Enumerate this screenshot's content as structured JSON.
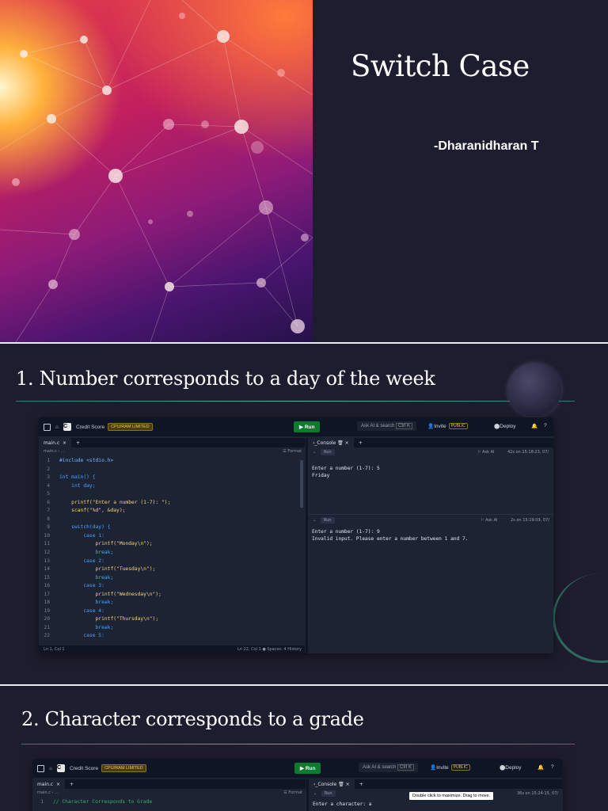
{
  "slide1": {
    "title": "Switch Case",
    "author": "-Dharanidharan T"
  },
  "slide2": {
    "heading": "1. Number corresponds to a day of the week",
    "app": {
      "project_name": "Credit Score",
      "resource_badge": "CPU/RAM LIMITED",
      "run_label": "Run",
      "ask_ai": "Ask AI & search",
      "shortcut": "Ctrl K",
      "invite": "Invite",
      "public_badge": "PUBLIC",
      "deploy": "Deploy",
      "help": "?",
      "file_tab": "main.c",
      "console_tab": "Console",
      "breadcrumb": "main.c › ...",
      "format": "Format",
      "status_left": "Ln 1, Col 1",
      "status_right": "Ln 22, Col 1  ●  Spaces: 4  History",
      "code_lines": [
        {
          "n": "1",
          "t": "#include <stdio.h>"
        },
        {
          "n": "2",
          "t": ""
        },
        {
          "n": "3",
          "t": "int main() {"
        },
        {
          "n": "4",
          "t": "    int day;"
        },
        {
          "n": "5",
          "t": ""
        },
        {
          "n": "6",
          "t": "    printf(\"Enter a number (1-7): \");"
        },
        {
          "n": "7",
          "t": "    scanf(\"%d\", &day);"
        },
        {
          "n": "8",
          "t": ""
        },
        {
          "n": "9",
          "t": "    switch(day) {"
        },
        {
          "n": "10",
          "t": "        case 1:"
        },
        {
          "n": "11",
          "t": "            printf(\"Monday\\n\");"
        },
        {
          "n": "12",
          "t": "            break;"
        },
        {
          "n": "13",
          "t": "        case 2:"
        },
        {
          "n": "14",
          "t": "            printf(\"Tuesday\\n\");"
        },
        {
          "n": "15",
          "t": "            break;"
        },
        {
          "n": "16",
          "t": "        case 3:"
        },
        {
          "n": "17",
          "t": "            printf(\"Wednesday\\n\");"
        },
        {
          "n": "18",
          "t": "            break;"
        },
        {
          "n": "19",
          "t": "        case 4:"
        },
        {
          "n": "20",
          "t": "            printf(\"Thursday\\n\");"
        },
        {
          "n": "21",
          "t": "            break;"
        },
        {
          "n": "22",
          "t": "        case 5:"
        }
      ],
      "runs": [
        {
          "pill": "Run",
          "ask": "Ask AI",
          "time": "42s on 15:18:23, 07/",
          "output": "Enter a number (1-7): 5\nFriday"
        },
        {
          "pill": "Run",
          "ask": "Ask AI",
          "time": "2s on 15:19:09, 07/",
          "output": "Enter a number (1-7): 9\nInvalid input. Please enter a number between 1 and 7."
        }
      ]
    }
  },
  "slide3": {
    "heading": "2. Character corresponds to a grade",
    "app": {
      "project_name": "Credit Score",
      "resource_badge": "CPU/RAM LIMITED",
      "run_label": "Run",
      "ask_ai": "Ask AI & search",
      "shortcut": "Ctrl K",
      "invite": "Invite",
      "public_badge": "PUBLIC",
      "deploy": "Deploy",
      "help": "?",
      "file_tab": "main.c",
      "console_tab": "Console",
      "breadcrumb": "main.c › ...",
      "format": "Format",
      "tooltip": "Double click to maximize. Drag to move.",
      "run_pill": "Run",
      "run_time": "36s on 15:24:15, 07/",
      "first_code_line": {
        "n": "1",
        "t": "// Character Corresponds to Grade"
      },
      "console_first": "Enter a character: a"
    }
  }
}
